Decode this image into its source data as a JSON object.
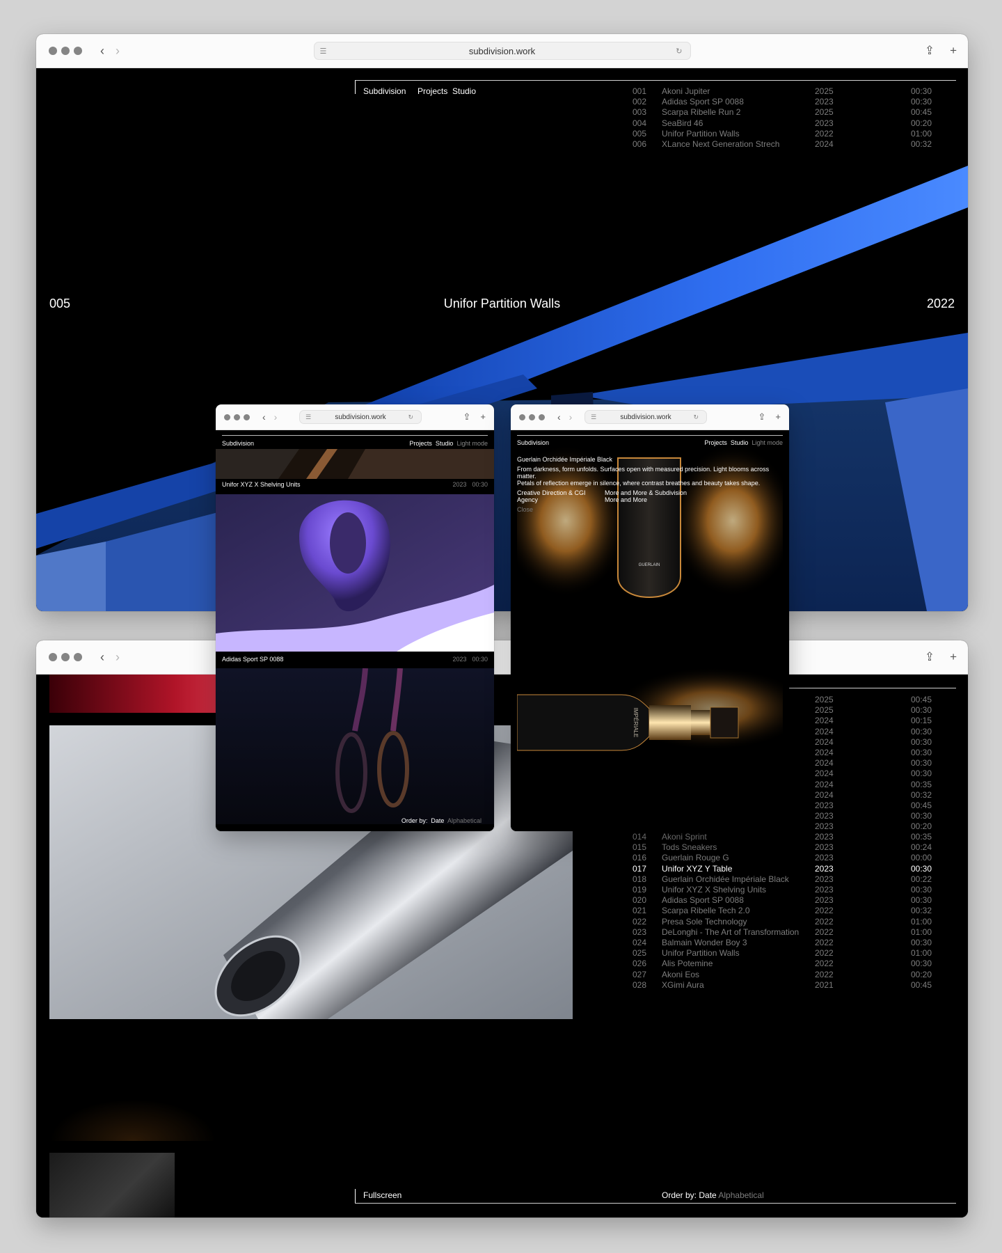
{
  "browser": {
    "url": "subdivision.work"
  },
  "top_window": {
    "brand": "Subdivision",
    "nav": [
      "Projects",
      "Studio"
    ],
    "projects": [
      {
        "num": "001",
        "title": "Akoni Jupiter",
        "year": "2025",
        "dur": "00:30"
      },
      {
        "num": "002",
        "title": "Adidas Sport SP 0088",
        "year": "2023",
        "dur": "00:30"
      },
      {
        "num": "003",
        "title": "Scarpa Ribelle Run 2",
        "year": "2025",
        "dur": "00:45"
      },
      {
        "num": "004",
        "title": "SeaBird 46",
        "year": "2023",
        "dur": "00:20"
      },
      {
        "num": "005",
        "title": "Unifor Partition Walls",
        "year": "2022",
        "dur": "01:00"
      },
      {
        "num": "006",
        "title": "XLance Next Generation Strech",
        "year": "2024",
        "dur": "00:32"
      }
    ],
    "feature": {
      "num": "005",
      "title": "Unifor Partition Walls",
      "year": "2022"
    }
  },
  "mobile_left": {
    "brand": "Subdivision",
    "nav": [
      "Projects",
      "Studio",
      "Light mode"
    ],
    "item1": {
      "title": "Unifor XYZ X Shelving Units",
      "year": "2023",
      "dur": "00:30"
    },
    "item2": {
      "title": "Adidas Sport SP 0088",
      "year": "2023",
      "dur": "00:30"
    },
    "order_label": "Order by:",
    "order_active": "Date",
    "order_other": "Alphabetical"
  },
  "mobile_right": {
    "brand": "Subdivision",
    "nav": [
      "Projects",
      "Studio",
      "Light mode"
    ],
    "title": "Guerlain Orchidée Impériale Black",
    "desc_line1": "From darkness, form unfolds. Surfaces open with measured precision. Light blooms across matter.",
    "desc_line2": "Petals of reflection emerge in silence, where contrast breathes and beauty takes shape.",
    "credit_left_1": "Creative Direction & CGI",
    "credit_left_2": "Agency",
    "credit_right_1": "More and More & Subdivision",
    "credit_right_2": "More and More",
    "close": "Close",
    "logo": "GUERLAIN",
    "bottle_text": "IMPÉRIALE"
  },
  "bottom_window": {
    "list_upper": [
      {
        "year": "2025",
        "dur": "00:45"
      },
      {
        "year": "2025",
        "dur": "00:30"
      },
      {
        "year": "2024",
        "dur": "00:15"
      },
      {
        "year": "2024",
        "dur": "00:30"
      },
      {
        "year": "2024",
        "dur": "00:30"
      },
      {
        "year": "2024",
        "dur": "00:30"
      },
      {
        "year": "2024",
        "dur": "00:30"
      },
      {
        "year": "2024",
        "dur": "00:30"
      },
      {
        "year": "2024",
        "dur": "00:35"
      },
      {
        "year": "2024",
        "dur": "00:32"
      },
      {
        "year": "2023",
        "dur": "00:45"
      },
      {
        "year": "2023",
        "dur": "00:30"
      },
      {
        "year": "2023",
        "dur": "00:20"
      }
    ],
    "projects": [
      {
        "num": "014",
        "title": "Akoni Sprint",
        "year": "2023",
        "dur": "00:35"
      },
      {
        "num": "015",
        "title": "Tods Sneakers",
        "year": "2023",
        "dur": "00:24"
      },
      {
        "num": "016",
        "title": "Guerlain Rouge G",
        "year": "2023",
        "dur": "00:00"
      },
      {
        "num": "017",
        "title": "Unifor XYZ Y Table",
        "year": "2023",
        "dur": "00:30"
      },
      {
        "num": "018",
        "title": "Guerlain Orchidée Impériale Black",
        "year": "2023",
        "dur": "00:22"
      },
      {
        "num": "019",
        "title": "Unifor XYZ X Shelving Units",
        "year": "2023",
        "dur": "00:30"
      },
      {
        "num": "020",
        "title": "Adidas Sport SP 0088",
        "year": "2023",
        "dur": "00:30"
      },
      {
        "num": "021",
        "title": "Scarpa Ribelle Tech 2.0",
        "year": "2022",
        "dur": "00:32"
      },
      {
        "num": "022",
        "title": "Presa Sole Technology",
        "year": "2022",
        "dur": "01:00"
      },
      {
        "num": "023",
        "title": "DeLonghi - The Art of Transformation",
        "year": "2022",
        "dur": "01:00"
      },
      {
        "num": "024",
        "title": "Balmain Wonder Boy 3",
        "year": "2022",
        "dur": "00:30"
      },
      {
        "num": "025",
        "title": "Unifor Partition Walls",
        "year": "2022",
        "dur": "01:00"
      },
      {
        "num": "026",
        "title": "Alis Potemine",
        "year": "2022",
        "dur": "00:30"
      },
      {
        "num": "027",
        "title": "Akoni Eos",
        "year": "2022",
        "dur": "00:20"
      },
      {
        "num": "028",
        "title": "XGimi Aura",
        "year": "2021",
        "dur": "00:45"
      }
    ],
    "fullscreen": "Fullscreen",
    "order_label": "Order by:",
    "order_active": "Date",
    "order_other": "Alphabetical"
  }
}
